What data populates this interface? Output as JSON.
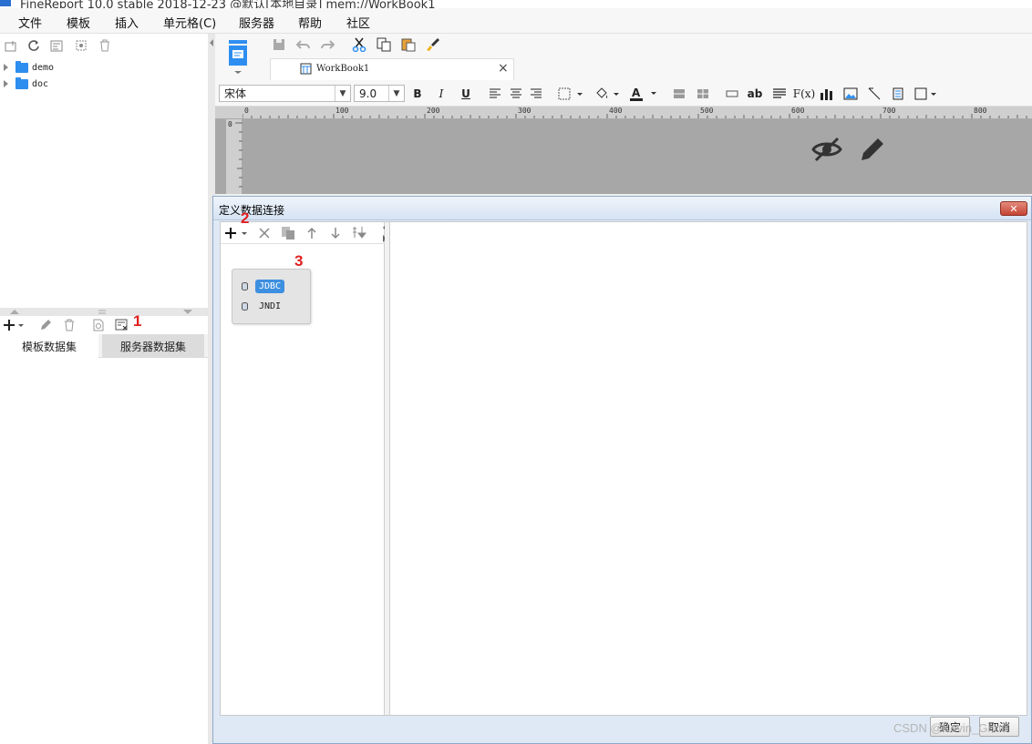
{
  "window": {
    "title": "FineReport 10.0 stable 2018-12-23 @默认[本地目录]    mem://WorkBook1"
  },
  "menu": {
    "items": [
      "文件",
      "模板",
      "插入",
      "单元格(C)",
      "服务器",
      "帮助",
      "社区"
    ]
  },
  "tree": {
    "items": [
      {
        "label": "demo"
      },
      {
        "label": "doc"
      }
    ]
  },
  "dataset_tabs": {
    "template": "模板数据集",
    "server": "服务器数据集"
  },
  "file_tab": {
    "label": "WorkBook1",
    "close": "×"
  },
  "format": {
    "font": "宋体",
    "size": "9.0",
    "bold": "B",
    "italic": "I",
    "underline": "U",
    "text": "ab",
    "formula": "F(x)"
  },
  "ruler": {
    "ticks": [
      "0",
      "100",
      "200",
      "300",
      "400",
      "500",
      "600",
      "700",
      "800"
    ],
    "vtick": "0"
  },
  "dialog": {
    "title": "定义数据连接",
    "close": "✕",
    "popup": [
      {
        "label": "JDBC",
        "selected": true
      },
      {
        "label": "JNDI",
        "selected": false
      }
    ],
    "ok": "确定",
    "cancel": "取消"
  },
  "annotations": {
    "n1": "1",
    "n2": "2",
    "n3": "3"
  },
  "watermark": "CSDN @Kevin_Ghou",
  "colors": {
    "accent": "#2e8ef0",
    "highlight": "#3d8fe0",
    "annotation": "#e02020"
  }
}
